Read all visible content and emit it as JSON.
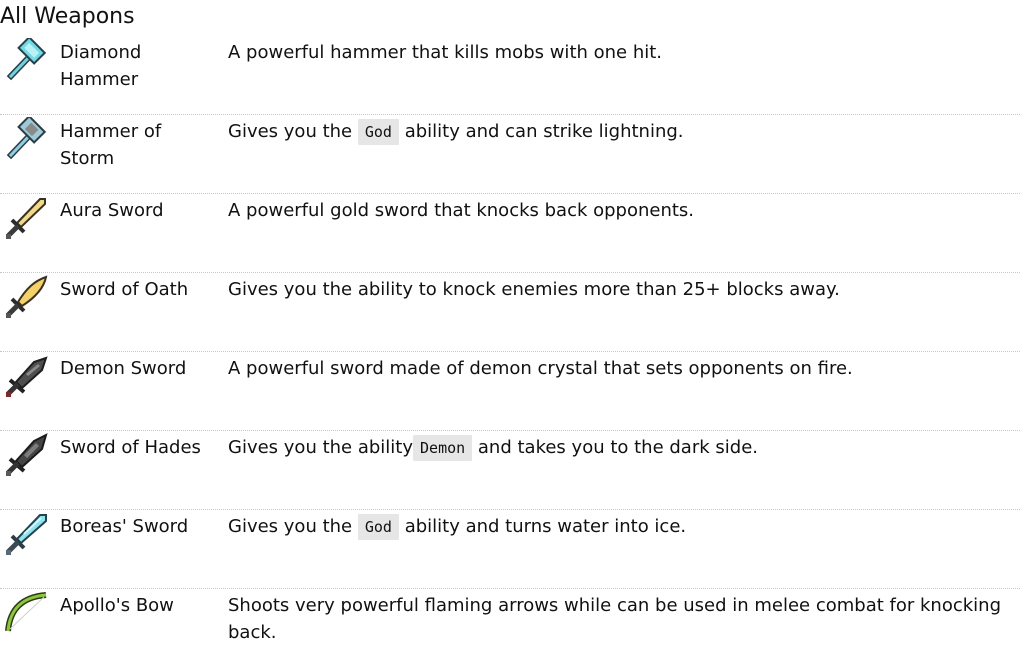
{
  "page": {
    "title": "All Weapons"
  },
  "weapons": [
    {
      "name": "Diamond Hammer",
      "icon": "diamond-hammer-icon",
      "desc_before": "A powerful hammer that kills mobs with one hit.",
      "code": "",
      "desc_after": ""
    },
    {
      "name": "Hammer of Storm",
      "icon": "storm-hammer-icon",
      "desc_before": "Gives you the",
      "code": "God",
      "desc_after": "ability and can strike lightning."
    },
    {
      "name": "Aura Sword",
      "icon": "gold-sword-icon",
      "desc_before": "A powerful gold sword that knocks back opponents.",
      "code": "",
      "desc_after": ""
    },
    {
      "name": "Sword of Oath",
      "icon": "oath-sword-icon",
      "desc_before": "Gives you the ability to knock enemies more than 25+ blocks away.",
      "code": "",
      "desc_after": ""
    },
    {
      "name": "Demon Sword",
      "icon": "demon-sword-icon",
      "desc_before": "A powerful sword made of demon crystal that sets opponents on fire.",
      "code": "",
      "desc_after": ""
    },
    {
      "name": "Sword of Hades",
      "icon": "hades-sword-icon",
      "desc_before": "Gives you the ability",
      "code": "Demon",
      "desc_after": "and takes you to the dark side."
    },
    {
      "name": "Boreas' Sword",
      "icon": "ice-sword-icon",
      "desc_before": "Gives you the",
      "code": "God",
      "desc_after": "ability and turns water into ice."
    },
    {
      "name": "Apollo's Bow",
      "icon": "bow-icon",
      "desc_before": "Shoots very powerful flaming arrows while can be used in melee combat for knocking back.",
      "code": "",
      "desc_after": ""
    }
  ]
}
